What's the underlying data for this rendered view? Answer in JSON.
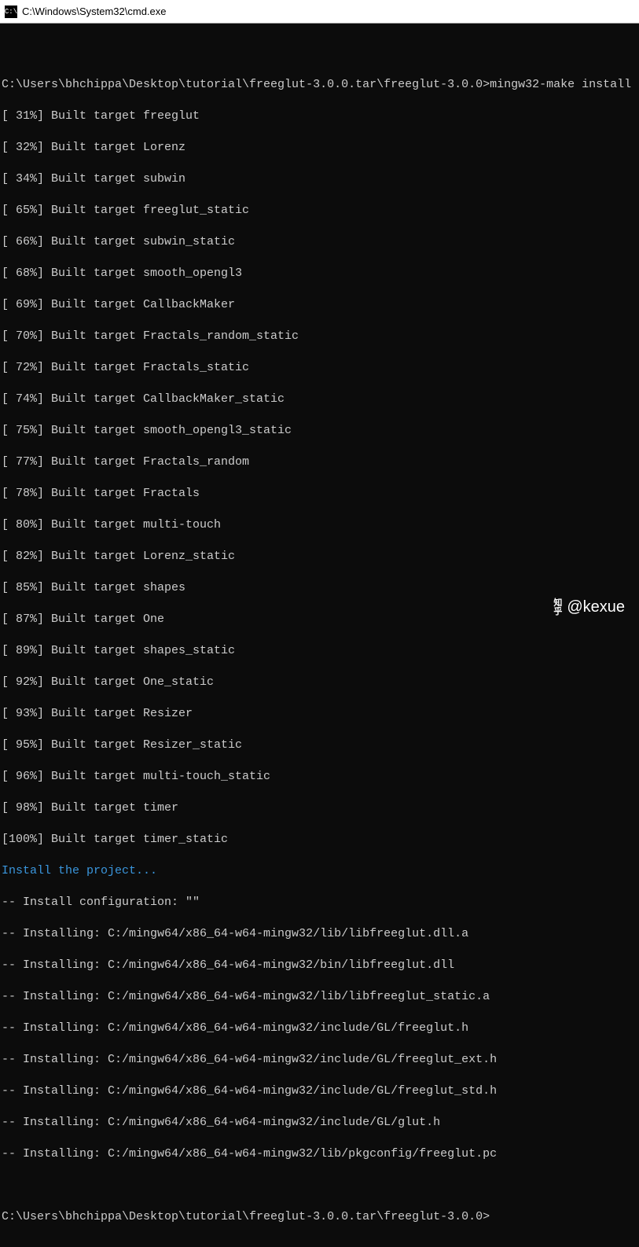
{
  "titlebar": {
    "icon_label": "C:\\",
    "title": "C:\\Windows\\System32\\cmd.exe"
  },
  "prompt_line": {
    "prompt": "C:\\Users\\bhchippa\\Desktop\\tutorial\\freeglut-3.0.0.tar\\freeglut-3.0.0>",
    "command": "mingw32-make install"
  },
  "build_lines": [
    "[ 31%] Built target freeglut",
    "[ 32%] Built target Lorenz",
    "[ 34%] Built target subwin",
    "[ 65%] Built target freeglut_static",
    "[ 66%] Built target subwin_static",
    "[ 68%] Built target smooth_opengl3",
    "[ 69%] Built target CallbackMaker",
    "[ 70%] Built target Fractals_random_static",
    "[ 72%] Built target Fractals_static",
    "[ 74%] Built target CallbackMaker_static",
    "[ 75%] Built target smooth_opengl3_static",
    "[ 77%] Built target Fractals_random",
    "[ 78%] Built target Fractals",
    "[ 80%] Built target multi-touch",
    "[ 82%] Built target Lorenz_static",
    "[ 85%] Built target shapes",
    "[ 87%] Built target One",
    "[ 89%] Built target shapes_static",
    "[ 92%] Built target One_static",
    "[ 93%] Built target Resizer",
    "[ 95%] Built target Resizer_static",
    "[ 96%] Built target multi-touch_static",
    "[ 98%] Built target timer",
    "[100%] Built target timer_static"
  ],
  "install_header": "Install the project...",
  "install_config": "-- Install configuration: \"\"",
  "install_lines": [
    "-- Installing: C:/mingw64/x86_64-w64-mingw32/lib/libfreeglut.dll.a",
    "-- Installing: C:/mingw64/x86_64-w64-mingw32/bin/libfreeglut.dll",
    "-- Installing: C:/mingw64/x86_64-w64-mingw32/lib/libfreeglut_static.a",
    "-- Installing: C:/mingw64/x86_64-w64-mingw32/include/GL/freeglut.h",
    "-- Installing: C:/mingw64/x86_64-w64-mingw32/include/GL/freeglut_ext.h",
    "-- Installing: C:/mingw64/x86_64-w64-mingw32/include/GL/freeglut_std.h",
    "-- Installing: C:/mingw64/x86_64-w64-mingw32/include/GL/glut.h",
    "-- Installing: C:/mingw64/x86_64-w64-mingw32/lib/pkgconfig/freeglut.pc"
  ],
  "final_prompt": "C:\\Users\\bhchippa\\Desktop\\tutorial\\freeglut-3.0.0.tar\\freeglut-3.0.0>",
  "watermark": {
    "logo_top": "知",
    "logo_bottom": "乎",
    "text": "@kexue"
  }
}
